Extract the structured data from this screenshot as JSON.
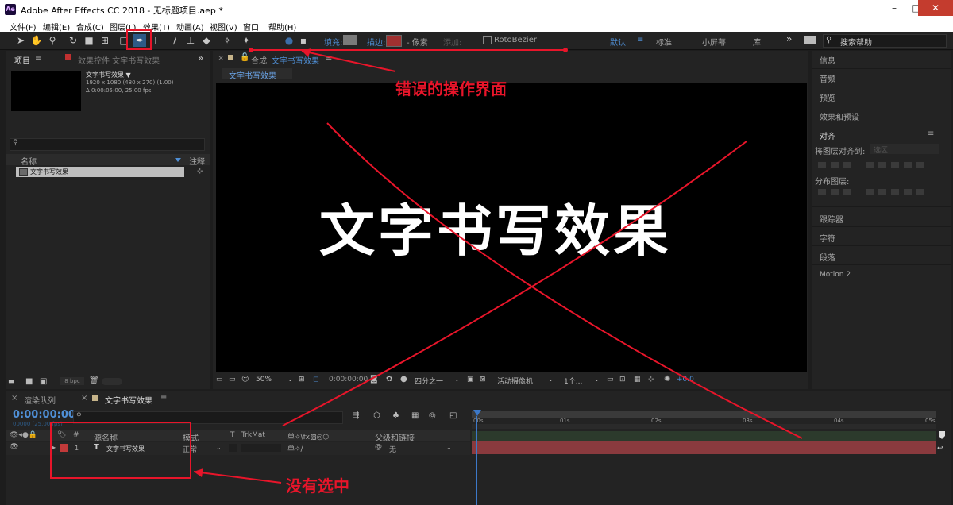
{
  "window": {
    "title": "Adobe After Effects CC 2018 - 无标题项目.aep *",
    "app_icon_text": "Ae"
  },
  "menu": [
    "文件(F)",
    "编辑(E)",
    "合成(C)",
    "图层(L)",
    "效果(T)",
    "动画(A)",
    "视图(V)",
    "窗口",
    "帮助(H)"
  ],
  "toolbar": {
    "fill_label": "填充:",
    "stroke_label": "描边:",
    "stroke_width": "- 像素",
    "add_label": "添加:",
    "rotobezier_label": "RotoBezier",
    "fill_color": "#7a7a7a",
    "stroke_color": "#a03030",
    "workspaces": [
      "默认",
      "标准",
      "小屏幕",
      "库"
    ],
    "workspace_more": "»",
    "search_placeholder": "搜索帮助"
  },
  "project_panel": {
    "tab_label": "项目",
    "effects_tab_label": "效果控件 文字书写效果",
    "item_name": "文字书写效果 ▼",
    "item_size": "1920 x 1080  (480 x 270) (1.00)",
    "item_duration": "Δ 0:00:05:00, 25.00 fps",
    "col_name": "名称",
    "col_comment": "注释",
    "row_name": "文字书写效果",
    "bpc_label": "8 bpc"
  },
  "comp_panel": {
    "tab_prefix": "合成",
    "tab_name": "文字书写效果",
    "subtab": "文字书写效果",
    "canvas_text": "文字书写效果",
    "zoom": "50%",
    "timecode": "0:00:00:00",
    "resolution": "四分之一",
    "camera": "活动摄像机",
    "views": "1个...",
    "exposure": "+0.0"
  },
  "right_panel": {
    "items_top": [
      "信息",
      "音频",
      "预览",
      "效果和预设"
    ],
    "align_title": "对齐",
    "align_to_label": "将图层对齐到:",
    "align_to_value": "选区",
    "distribute_label": "分布图层:",
    "items_bottom": [
      "跟踪器",
      "字符",
      "段落",
      "Motion 2"
    ]
  },
  "timeline": {
    "render_queue_tab": "渲染队列",
    "comp_tab": "文字书写效果",
    "timecode": "0:00:00:00",
    "frames": "00000 (25.00 fps)",
    "col_num": "#",
    "col_source": "源名称",
    "col_mode": "模式",
    "col_t": "T",
    "col_trkmat": "TrkMat",
    "col_parent": "父级和链接",
    "layer_num": "1",
    "layer_type": "T",
    "layer_name": "文字书写效果",
    "layer_mode": "正常",
    "layer_parent": "无",
    "ticks": [
      "00s",
      "01s",
      "02s",
      "03s",
      "04s",
      "05s"
    ],
    "layer_bar_color": "#8a3a3e"
  },
  "annotations": {
    "wrong_ui": "错误的操作界面",
    "not_selected": "没有选中",
    "color": "#e8152a"
  }
}
